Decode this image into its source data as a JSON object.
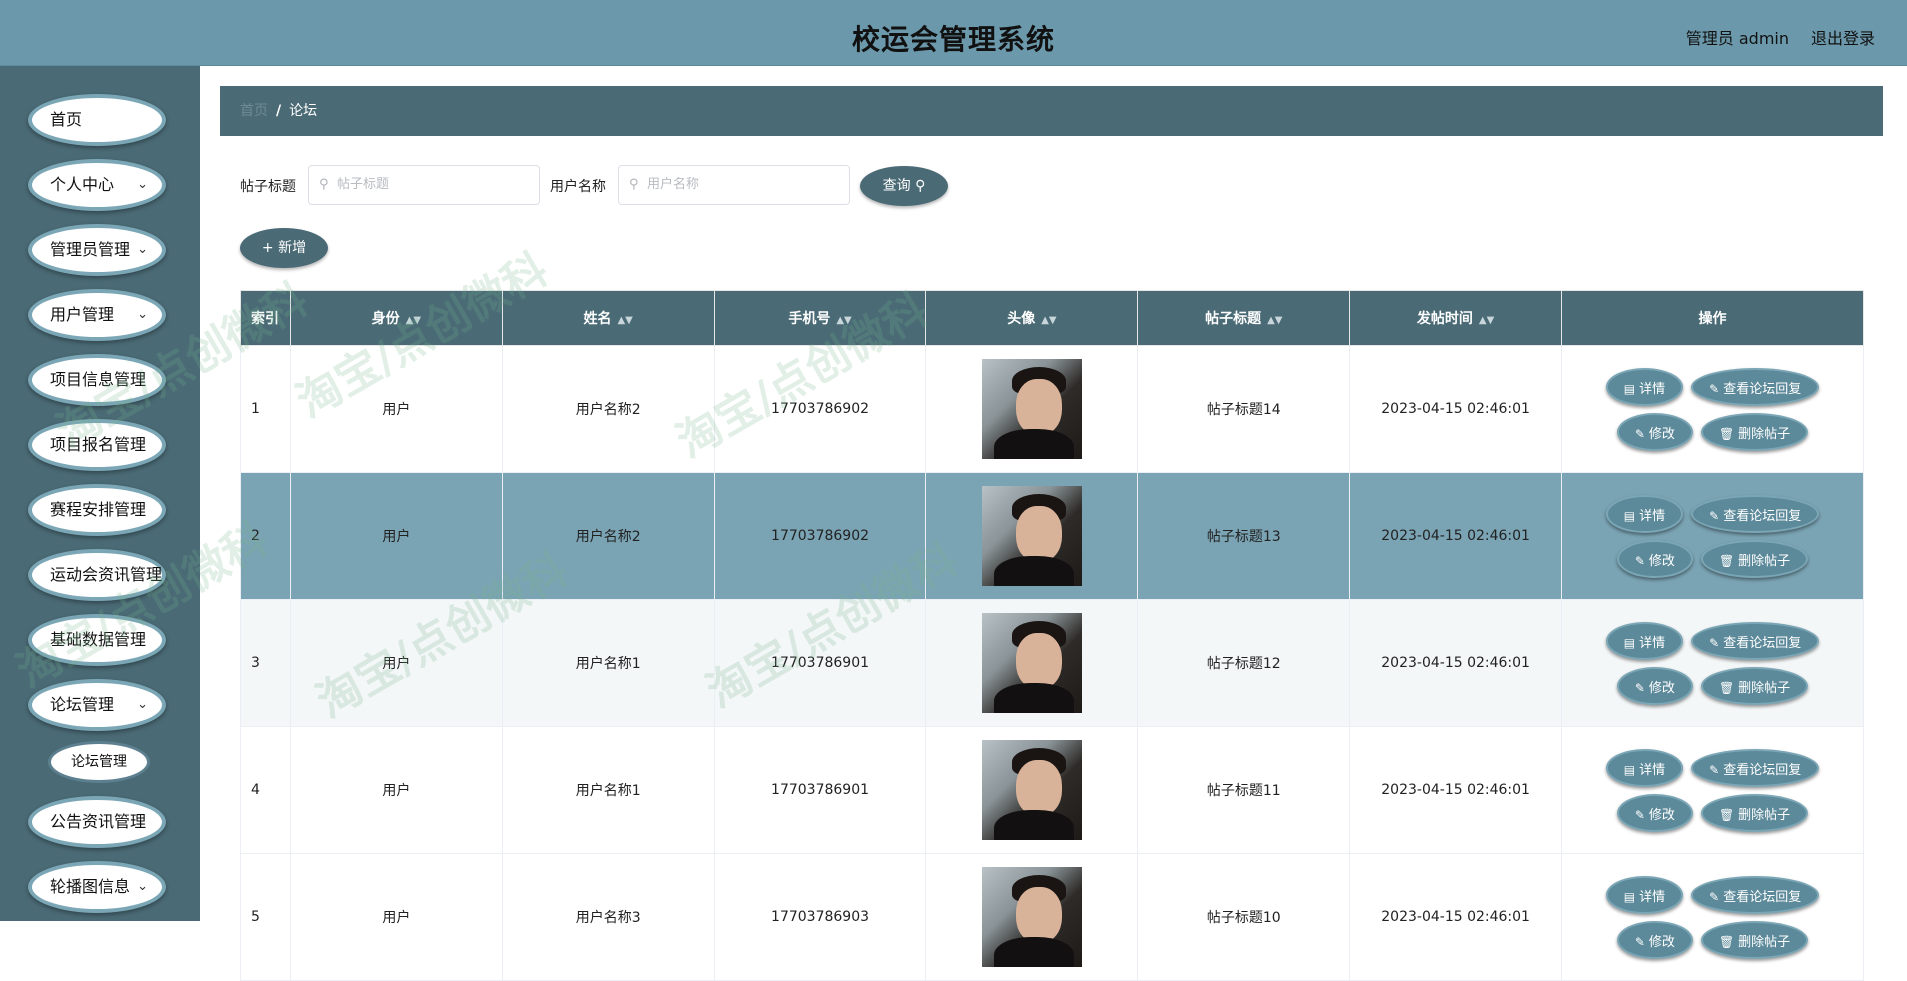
{
  "header": {
    "title": "校运会管理系统",
    "user": "管理员 admin",
    "logout": "退出登录"
  },
  "sidebar": {
    "items": [
      {
        "label": "首页",
        "chevron": false
      },
      {
        "label": "个人中心",
        "chevron": true
      },
      {
        "label": "管理员管理",
        "chevron": true
      },
      {
        "label": "用户管理",
        "chevron": true
      },
      {
        "label": "项目信息管理",
        "chevron": false
      },
      {
        "label": "项目报名管理",
        "chevron": false
      },
      {
        "label": "赛程安排管理",
        "chevron": false
      },
      {
        "label": "运动会资讯管理",
        "chevron": false
      },
      {
        "label": "基础数据管理",
        "chevron": false
      },
      {
        "label": "论坛管理",
        "chevron": true
      },
      {
        "label": "公告资讯管理",
        "chevron": false
      },
      {
        "label": "轮播图信息",
        "chevron": true
      }
    ],
    "sub_item": "论坛管理"
  },
  "breadcrumb": {
    "home": "首页",
    "separator": "/",
    "current": "论坛"
  },
  "search": {
    "title_label": "帖子标题",
    "title_placeholder": "帖子标题",
    "name_label": "用户名称",
    "name_placeholder": "用户名称",
    "query_button": "查询"
  },
  "toolbar": {
    "add_button": "新增"
  },
  "table": {
    "headers": [
      "索引",
      "身份",
      "姓名",
      "手机号",
      "头像",
      "帖子标题",
      "发帖时间",
      "操作"
    ],
    "rows": [
      {
        "index": "1",
        "role": "用户",
        "name": "用户名称2",
        "phone": "17703786902",
        "title": "帖子标题14",
        "time": "2023-04-15 02:46:01"
      },
      {
        "index": "2",
        "role": "用户",
        "name": "用户名称2",
        "phone": "17703786902",
        "title": "帖子标题13",
        "time": "2023-04-15 02:46:01"
      },
      {
        "index": "3",
        "role": "用户",
        "name": "用户名称1",
        "phone": "17703786901",
        "title": "帖子标题12",
        "time": "2023-04-15 02:46:01"
      },
      {
        "index": "4",
        "role": "用户",
        "name": "用户名称1",
        "phone": "17703786901",
        "title": "帖子标题11",
        "time": "2023-04-15 02:46:01"
      },
      {
        "index": "5",
        "role": "用户",
        "name": "用户名称3",
        "phone": "17703786903",
        "title": "帖子标题10",
        "time": "2023-04-15 02:46:01"
      }
    ],
    "actions": {
      "detail": "详情",
      "reply": "查看论坛回复",
      "edit": "修改",
      "delete": "删除帖子"
    }
  },
  "watermark": "淘宝/点创微科"
}
